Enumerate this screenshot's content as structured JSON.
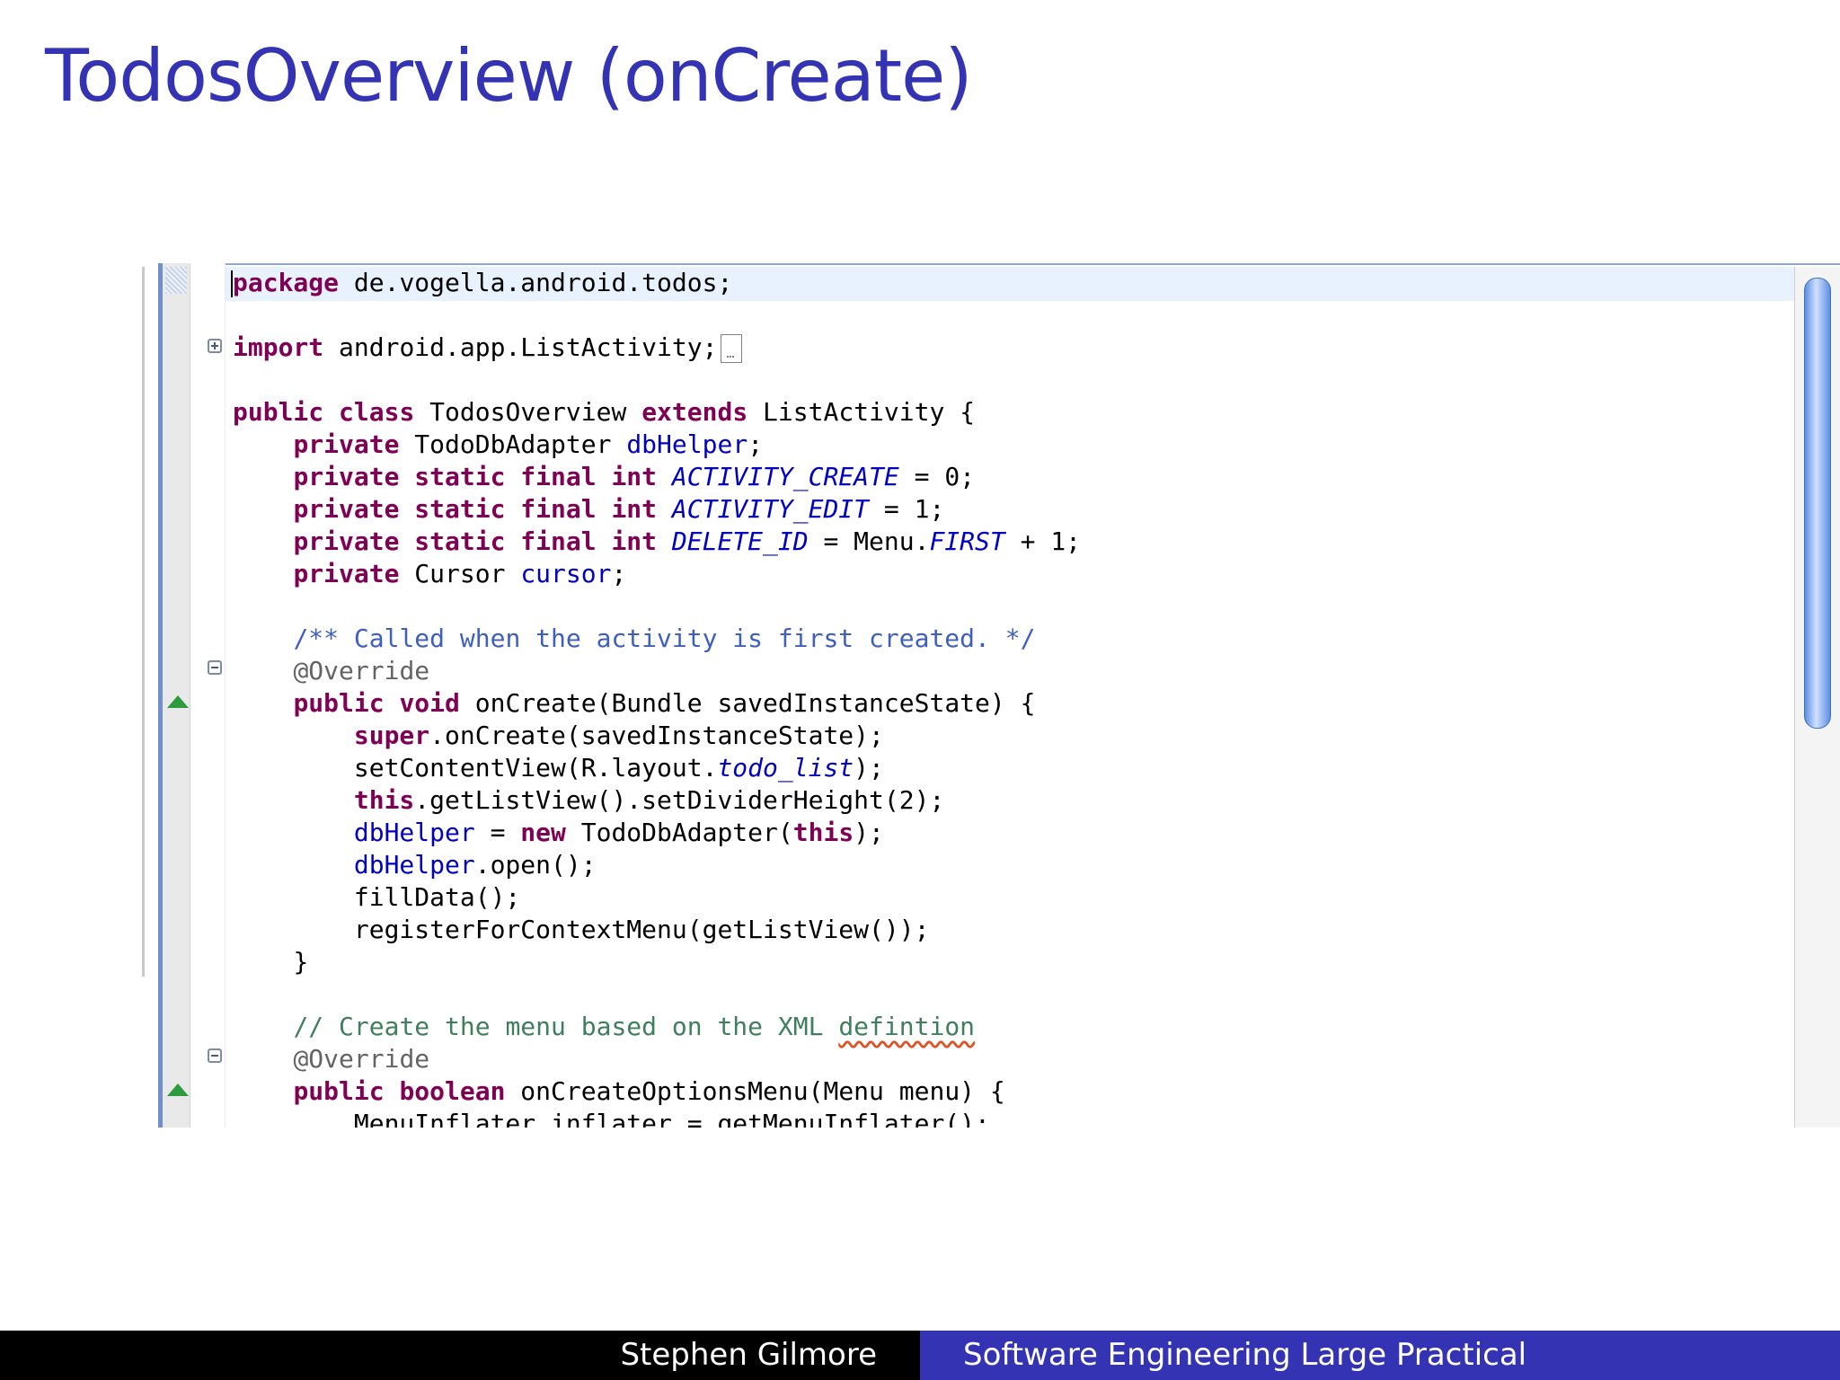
{
  "slide": {
    "title": "TodosOverview (onCreate)",
    "footer_author": "Stephen Gilmore",
    "footer_course": "Software Engineering Large Practical"
  },
  "colors": {
    "title": "#3333b3",
    "footer_left": "#000000",
    "footer_right": "#3333b3",
    "keyword": "#7f0055",
    "field": "#0000c0",
    "javadoc": "#3f5fbf",
    "comment": "#3f7f5f",
    "annotation": "#646464",
    "override_marker": "#2e9a3e"
  },
  "icons": {
    "import_fold": "plus-fold-icon",
    "method_fold": "minus-fold-icon",
    "override_marker": "green-triangle-icon"
  },
  "editor": {
    "line1": {
      "kw": "package",
      "rest": " de.vogella.android.todos;"
    },
    "line2": {
      "kw": "import",
      "rest": " android.app.ListActivity;"
    },
    "line3": {
      "kw1": "public",
      "kw2": "class",
      "name": " TodosOverview ",
      "kw3": "extends",
      "rest": " ListActivity {"
    },
    "line4": {
      "kw": "private",
      "type": " TodoDbAdapter ",
      "field": "dbHelper",
      "end": ";"
    },
    "line5": {
      "kw": "private static final int",
      "field": "ACTIVITY_CREATE",
      "end": " = 0;"
    },
    "line6": {
      "kw": "private static final int",
      "field": "ACTIVITY_EDIT",
      "end": " = 1;"
    },
    "line7": {
      "kw": "private static final int",
      "field": "DELETE_ID",
      "mid": " = Menu.",
      "field2": "FIRST",
      "end": " + 1;"
    },
    "line8": {
      "kw": "private",
      "type": " Cursor ",
      "field": "cursor",
      "end": ";"
    },
    "line9": {
      "comment": "/** Called when the activity is first created. */"
    },
    "line10": {
      "annotation": "@Override"
    },
    "line11": {
      "kw": "public void",
      "rest": " onCreate(Bundle savedInstanceState) {"
    },
    "line12": {
      "kw": "super",
      "rest": ".onCreate(savedInstanceState);"
    },
    "line13": {
      "pre": "setContentView(R.layout.",
      "field": "todo_list",
      "end": ");"
    },
    "line14": {
      "kw": "this",
      "rest": ".getListView().setDividerHeight(2);"
    },
    "line15": {
      "field": "dbHelper",
      "mid": " = ",
      "kw": "new",
      "rest": " TodoDbAdapter(",
      "kw2": "this",
      "end": ");"
    },
    "line16": {
      "field": "dbHelper",
      "end": ".open();"
    },
    "line17": {
      "text": "fillData();"
    },
    "line18": {
      "text": "registerForContextMenu(getListView());"
    },
    "line19": {
      "text": "}"
    },
    "line20": {
      "comment": "// Create the menu based on the XML ",
      "squiggly": "defintion"
    },
    "line21": {
      "annotation": "@Override"
    },
    "line22": {
      "kw": "public boolean",
      "rest": " onCreateOptionsMenu(Menu menu) {"
    },
    "line23": {
      "text": "MenuInflater inflater = getMenuInflater();"
    }
  }
}
